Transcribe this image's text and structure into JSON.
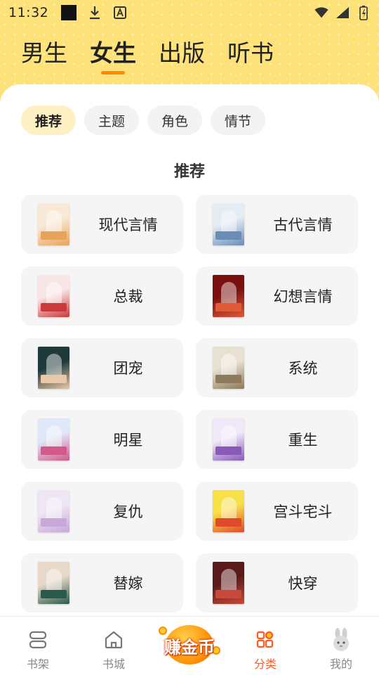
{
  "status_bar": {
    "time": "11:32",
    "icons": [
      "notification-square-icon",
      "download-icon",
      "font-a-icon",
      "wifi-icon",
      "signal-icon",
      "battery-charging-icon"
    ]
  },
  "top_tabs": [
    {
      "label": "男生",
      "active": false
    },
    {
      "label": "女生",
      "active": true
    },
    {
      "label": "出版",
      "active": false
    },
    {
      "label": "听书",
      "active": false
    }
  ],
  "chips": [
    {
      "label": "推荐",
      "active": true
    },
    {
      "label": "主题",
      "active": false
    },
    {
      "label": "角色",
      "active": false
    },
    {
      "label": "情节",
      "active": false
    }
  ],
  "section_title": "推荐",
  "categories": [
    {
      "label": "现代言情",
      "cover_colors": [
        "#f7e9d6",
        "#e8a35a"
      ]
    },
    {
      "label": "古代言情",
      "cover_colors": [
        "#e4ecf4",
        "#6a8db8"
      ]
    },
    {
      "label": "总裁",
      "cover_colors": [
        "#f8e6e6",
        "#c93a3a"
      ]
    },
    {
      "label": "幻想言情",
      "cover_colors": [
        "#7a1010",
        "#e05a3a"
      ]
    },
    {
      "label": "团宠",
      "cover_colors": [
        "#1e3a3a",
        "#e8c8a8"
      ]
    },
    {
      "label": "系统",
      "cover_colors": [
        "#e8e0d0",
        "#8c7a5a"
      ]
    },
    {
      "label": "明星",
      "cover_colors": [
        "#dfe8f8",
        "#d05a8a"
      ]
    },
    {
      "label": "重生",
      "cover_colors": [
        "#eee8f8",
        "#8a5ab8"
      ]
    },
    {
      "label": "复仇",
      "cover_colors": [
        "#eee6f4",
        "#c8a8d8"
      ]
    },
    {
      "label": "宫斗宅斗",
      "cover_colors": [
        "#f8e048",
        "#e04a2a"
      ]
    },
    {
      "label": "替嫁",
      "cover_colors": [
        "#e8d8c8",
        "#2a5a4a"
      ]
    },
    {
      "label": "快穿",
      "cover_colors": [
        "#5a1a1a",
        "#c84a3a"
      ]
    }
  ],
  "bottom_nav": [
    {
      "label": "书架",
      "icon": "bookshelf-icon",
      "active": false
    },
    {
      "label": "书城",
      "icon": "home-icon",
      "active": false
    },
    {
      "label": "赚金币",
      "icon": "earn-coins-badge",
      "active": false
    },
    {
      "label": "分类",
      "icon": "category-grid-icon",
      "active": true
    },
    {
      "label": "我的",
      "icon": "rabbit-avatar-icon",
      "active": false
    }
  ],
  "colors": {
    "accent": "#ff8a00",
    "nav_active": "#ff5a1f",
    "header_bg": "#fde27a",
    "chip_active_bg": "#fdf0c2"
  }
}
